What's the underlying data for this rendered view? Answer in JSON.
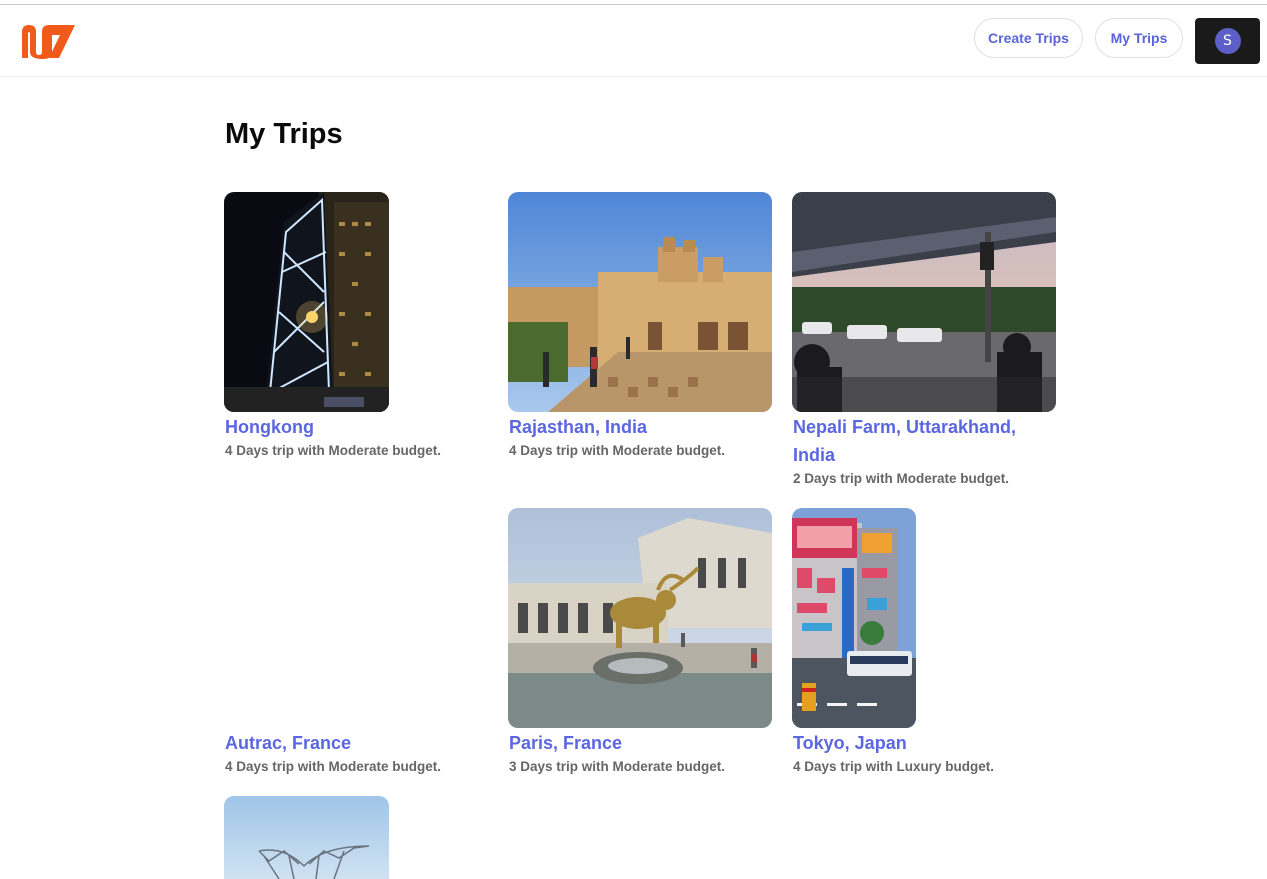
{
  "header": {
    "logo_icon": "brand-logo-icon",
    "create_trips_label": "Create Trips",
    "my_trips_label": "My Trips",
    "avatar_initial": "S"
  },
  "page": {
    "title": "My Trips"
  },
  "trips": [
    {
      "name": "Hongkong",
      "detail": "4 Days trip with Moderate budget."
    },
    {
      "name": "Rajasthan, India",
      "detail": "4 Days trip with Moderate budget."
    },
    {
      "name_line1": "Nepali Farm, Uttarakhand,",
      "name_line2": "India",
      "detail": "2 Days trip with Moderate budget."
    },
    {
      "name": "Autrac, France",
      "detail": "4 Days trip with Moderate budget."
    },
    {
      "name": "Paris, France",
      "detail": "3 Days trip with Moderate budget."
    },
    {
      "name": "Tokyo, Japan",
      "detail": "4 Days trip with Luxury budget."
    }
  ],
  "colors": {
    "accent": "#5b67e0",
    "logo": "#f05a1a",
    "user_button": "#1a1a1a",
    "avatar": "#5b5fc7"
  }
}
